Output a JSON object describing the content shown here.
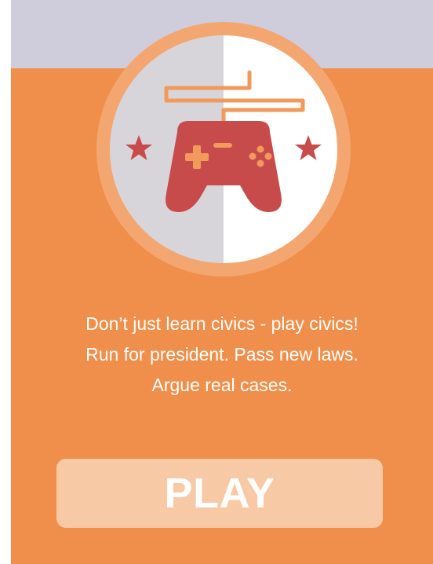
{
  "colors": {
    "background_top": "#cfcddc",
    "card_orange": "#ef8f4b",
    "ring_orange": "#f4a671",
    "disc_gray": "#d7d5da",
    "disc_white": "#ffffff",
    "cord_orange": "#f29a5c",
    "controller_red": "#c84b4c",
    "play_button_bg": "#f8c9a5",
    "text_white": "#ffffff"
  },
  "icon": {
    "emblem": "game-controller-icon",
    "left_accent": "star-icon",
    "right_accent": "star-icon"
  },
  "tagline": {
    "line1": "Don’t just learn civics - play civics!",
    "line2": "Run for president. Pass new laws.",
    "line3": "Argue real cases."
  },
  "play_button": {
    "label": "PLAY"
  }
}
